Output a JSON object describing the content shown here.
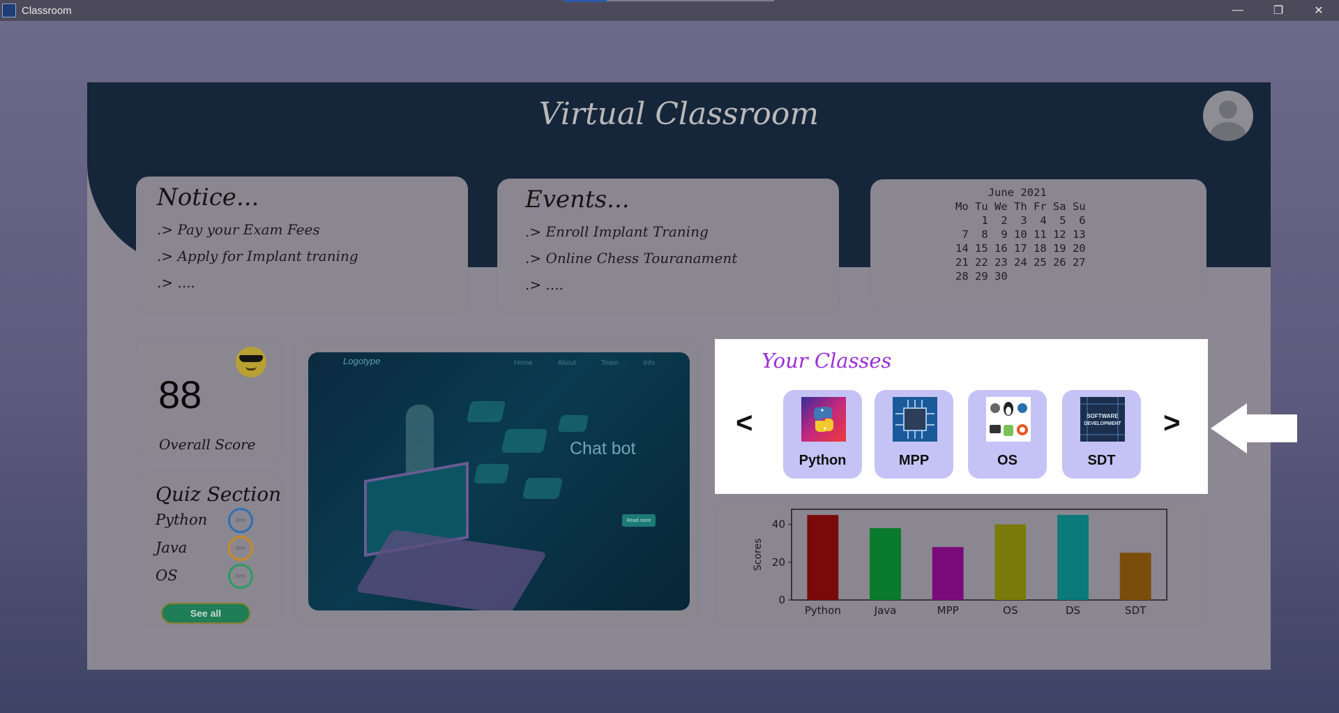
{
  "window": {
    "title": "Classroom",
    "minimize": "—",
    "restore": "❐",
    "close": "✕"
  },
  "header": {
    "title": "Virtual Classroom"
  },
  "notice": {
    "title": "Notice...",
    "lines": [
      ".> Pay your Exam Fees",
      ".> Apply for Implant traning",
      ".> ...."
    ]
  },
  "events": {
    "title": "Events...",
    "lines": [
      ".> Enroll Implant Traning",
      ".> Online Chess Touranament",
      ".> ...."
    ]
  },
  "calendar": {
    "text": "     June 2021\nMo Tu We Th Fr Sa Su\n    1  2  3  4  5  6\n 7  8  9 10 11 12 13\n14 15 16 17 18 19 20\n21 22 23 24 25 26 27\n28 29 30"
  },
  "score": {
    "value": "88",
    "label": "Overall Score"
  },
  "quiz": {
    "title": "Quiz Section",
    "items": [
      {
        "name": "Python",
        "progress": "90%",
        "color": "#2d6fb5"
      },
      {
        "name": "Java",
        "progress": "80%",
        "color": "#c98a1e"
      },
      {
        "name": "OS",
        "progress": "60%",
        "color": "#2a9b63"
      }
    ],
    "see_all": "See all"
  },
  "banner": {
    "logo": "Logotype",
    "links": [
      "Home",
      "About",
      "Team",
      "Info"
    ],
    "headline": "Chat bot",
    "button": "Read more"
  },
  "classes": {
    "title": "Your Classes",
    "prev": "<",
    "next": ">",
    "items": [
      {
        "name": "Python",
        "icon": "python-logo-icon"
      },
      {
        "name": "MPP",
        "icon": "chip-icon"
      },
      {
        "name": "OS",
        "icon": "os-logos-icon"
      },
      {
        "name": "SDT",
        "icon": "software-development-icon"
      }
    ]
  },
  "chart_data": {
    "type": "bar",
    "categories": [
      "Python",
      "Java",
      "MPP",
      "OS",
      "DS",
      "SDT"
    ],
    "values": [
      45,
      38,
      28,
      40,
      45,
      25
    ],
    "colors": [
      "#7a0a0a",
      "#0a7a2d",
      "#7a0a7a",
      "#7a7a0a",
      "#0a7a7a",
      "#7a4e0a"
    ],
    "xlabel": "",
    "ylabel": "Scores",
    "yticks": [
      0,
      20,
      40
    ],
    "ylim": [
      0,
      48
    ]
  }
}
